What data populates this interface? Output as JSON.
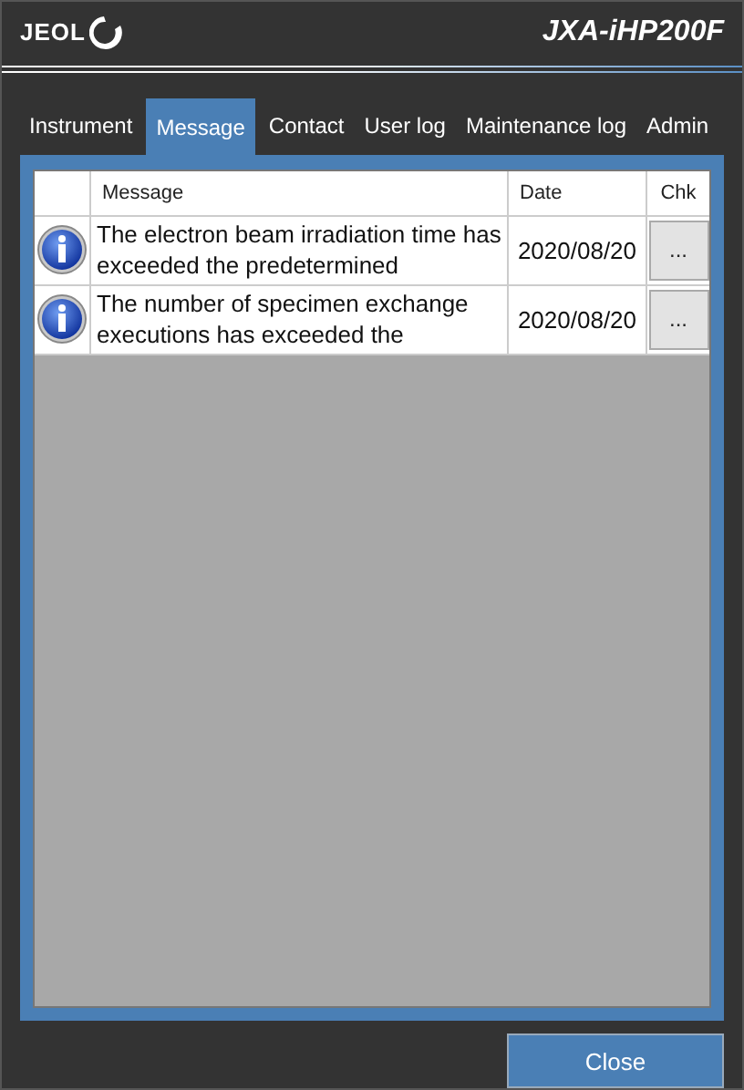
{
  "header": {
    "logo": "JEOL",
    "model": "JXA-iHP200F"
  },
  "tabs": [
    {
      "label": "Instrument",
      "selected": false
    },
    {
      "label": "Message",
      "selected": true
    },
    {
      "label": "Contact",
      "selected": false
    },
    {
      "label": "User log",
      "selected": false
    },
    {
      "label": "Maintenance log",
      "selected": false
    },
    {
      "label": "Admin",
      "selected": false
    }
  ],
  "table": {
    "columns": [
      "Message",
      "Date",
      "Chk"
    ],
    "rows": [
      {
        "message": "The electron beam irradiation time has exceeded the predetermined",
        "date": "2020/08/20",
        "action": "..."
      },
      {
        "message": "The number of specimen exchange executions has exceeded the",
        "date": "2020/08/20",
        "action": "..."
      }
    ]
  },
  "buttons": [
    "Close"
  ]
}
